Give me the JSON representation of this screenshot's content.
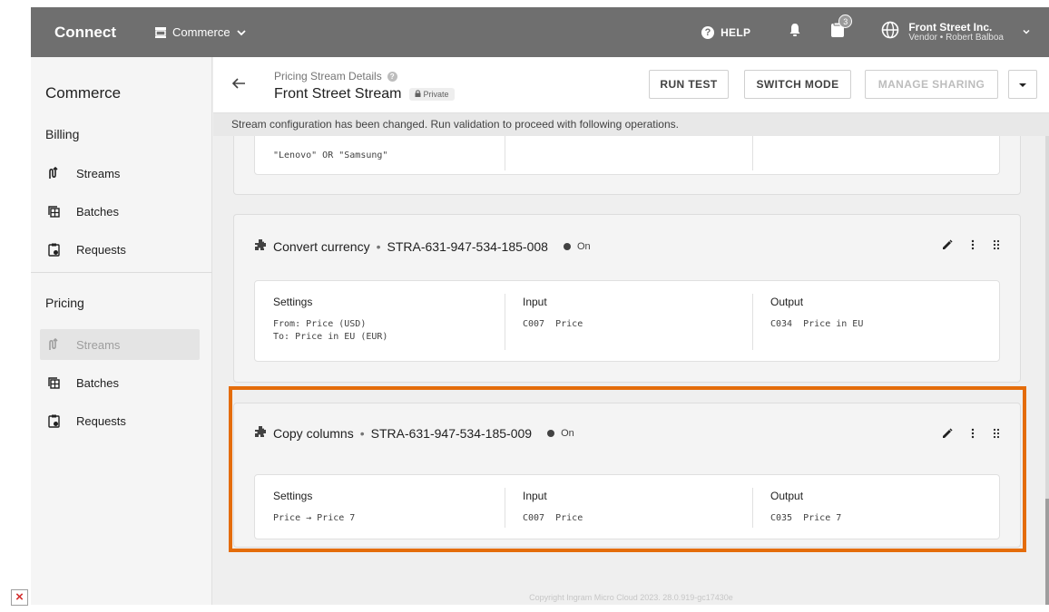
{
  "topbar": {
    "brand": "Connect",
    "module": "Commerce",
    "help_label": "HELP",
    "tasks_badge": "3",
    "account_name": "Front Street Inc.",
    "account_sub": "Vendor • Robert Balboa"
  },
  "sidebar": {
    "title": "Commerce",
    "sections": [
      {
        "title": "Billing",
        "items": [
          {
            "label": "Streams",
            "icon": "stream-icon"
          },
          {
            "label": "Batches",
            "icon": "batches-icon"
          },
          {
            "label": "Requests",
            "icon": "requests-icon"
          }
        ]
      },
      {
        "title": "Pricing",
        "items": [
          {
            "label": "Streams",
            "icon": "stream-icon",
            "active": true
          },
          {
            "label": "Batches",
            "icon": "batches-icon"
          },
          {
            "label": "Requests",
            "icon": "requests-icon"
          }
        ]
      }
    ]
  },
  "header": {
    "eyebrow": "Pricing Stream Details",
    "title": "Front Street Stream",
    "privacy": "Private",
    "run_test": "RUN TEST",
    "switch_mode": "SWITCH MODE",
    "manage_sharing": "MANAGE SHARING"
  },
  "notice": "Stream configuration has been changed. Run validation to proceed with following operations.",
  "prev_card": {
    "filter_text": "\"Lenovo\" OR \"Samsung\""
  },
  "cards": [
    {
      "name": "Convert currency",
      "id": "STRA-631-947-534-185-008",
      "status": "On",
      "settings_label": "Settings",
      "settings_lines": "From: Price (USD)\nTo: Price in EU (EUR)",
      "input_label": "Input",
      "input_value": "C007  Price",
      "output_label": "Output",
      "output_value": "C034  Price in EU"
    },
    {
      "name": "Copy columns",
      "id": "STRA-631-947-534-185-009",
      "status": "On",
      "settings_label": "Settings",
      "settings_lines": "Price → Price 7",
      "input_label": "Input",
      "input_value": "C007  Price",
      "output_label": "Output",
      "output_value": "C035  Price 7"
    }
  ],
  "footer": "Copyright Ingram Micro Cloud 2023. 28.0.919-gc17430e",
  "colors": {
    "topbar": "#6f6f6f",
    "highlight": "#e46c0a"
  }
}
